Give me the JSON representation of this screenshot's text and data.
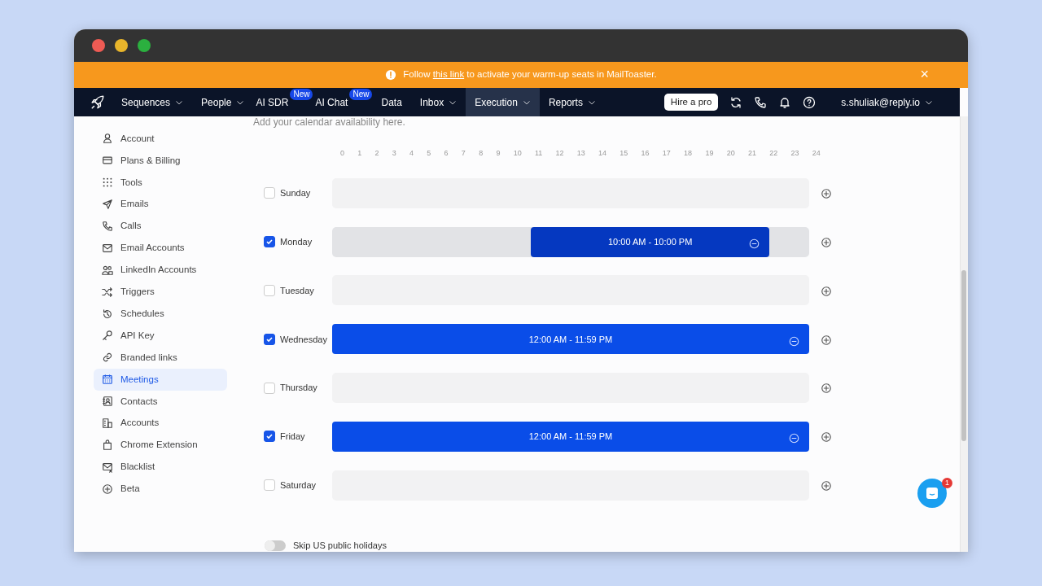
{
  "banner": {
    "before": "Follow ",
    "link": "this link",
    "after": " to activate your warm-up seats in MailToaster.",
    "close": "×"
  },
  "navbar": {
    "items": [
      {
        "label": "Sequences",
        "dropdown": true,
        "selected": false
      },
      {
        "label": "People",
        "dropdown": true,
        "selected": false
      },
      {
        "label": "AI SDR",
        "dropdown": false,
        "badge": "New",
        "selected": false
      },
      {
        "label": "AI Chat",
        "dropdown": false,
        "badge": "New",
        "selected": false
      },
      {
        "label": "Data",
        "dropdown": false,
        "selected": false
      },
      {
        "label": "Inbox",
        "dropdown": true,
        "selected": false
      },
      {
        "label": "Execution",
        "dropdown": true,
        "selected": true
      },
      {
        "label": "Reports",
        "dropdown": true,
        "selected": false
      }
    ],
    "hire_button": "Hire a pro",
    "user": "s.shuliak@reply.io"
  },
  "sidebar": {
    "items": [
      {
        "label": "Account",
        "selected": false
      },
      {
        "label": "Plans & Billing",
        "selected": false
      },
      {
        "label": "Tools",
        "selected": false
      },
      {
        "label": "Emails",
        "selected": false
      },
      {
        "label": "Calls",
        "selected": false
      },
      {
        "label": "Email Accounts",
        "selected": false
      },
      {
        "label": "LinkedIn Accounts",
        "selected": false
      },
      {
        "label": "Triggers",
        "selected": false
      },
      {
        "label": "Schedules",
        "selected": false
      },
      {
        "label": "API Key",
        "selected": false
      },
      {
        "label": "Branded links",
        "selected": false
      },
      {
        "label": "Meetings",
        "selected": true
      },
      {
        "label": "Contacts",
        "selected": false
      },
      {
        "label": "Accounts",
        "selected": false
      },
      {
        "label": "Chrome Extension",
        "selected": false
      },
      {
        "label": "Blacklist",
        "selected": false
      },
      {
        "label": "Beta",
        "selected": false
      }
    ]
  },
  "availability": {
    "subtitle": "Add your calendar availability here.",
    "hours": [
      "0",
      "1",
      "2",
      "3",
      "4",
      "5",
      "6",
      "7",
      "8",
      "9",
      "10",
      "11",
      "12",
      "13",
      "14",
      "15",
      "16",
      "17",
      "18",
      "19",
      "20",
      "21",
      "22",
      "23",
      "24"
    ],
    "days": [
      {
        "label": "Sunday",
        "checked": false,
        "hovered": false
      },
      {
        "label": "Monday",
        "checked": true,
        "hovered": true,
        "slot": {
          "text": "10:00 AM - 10:00 PM"
        }
      },
      {
        "label": "Tuesday",
        "checked": false,
        "hovered": false
      },
      {
        "label": "Wednesday",
        "checked": true,
        "hovered": false,
        "slot": {
          "text": "12:00 AM - 11:59 PM"
        }
      },
      {
        "label": "Thursday",
        "checked": false,
        "hovered": false
      },
      {
        "label": "Friday",
        "checked": true,
        "hovered": false,
        "slot": {
          "text": "12:00 AM - 11:59 PM"
        }
      },
      {
        "label": "Saturday",
        "checked": false,
        "hovered": false
      }
    ],
    "holidays": {
      "label": "Skip US public holidays",
      "on": false
    }
  },
  "chat": {
    "badge": "1"
  }
}
